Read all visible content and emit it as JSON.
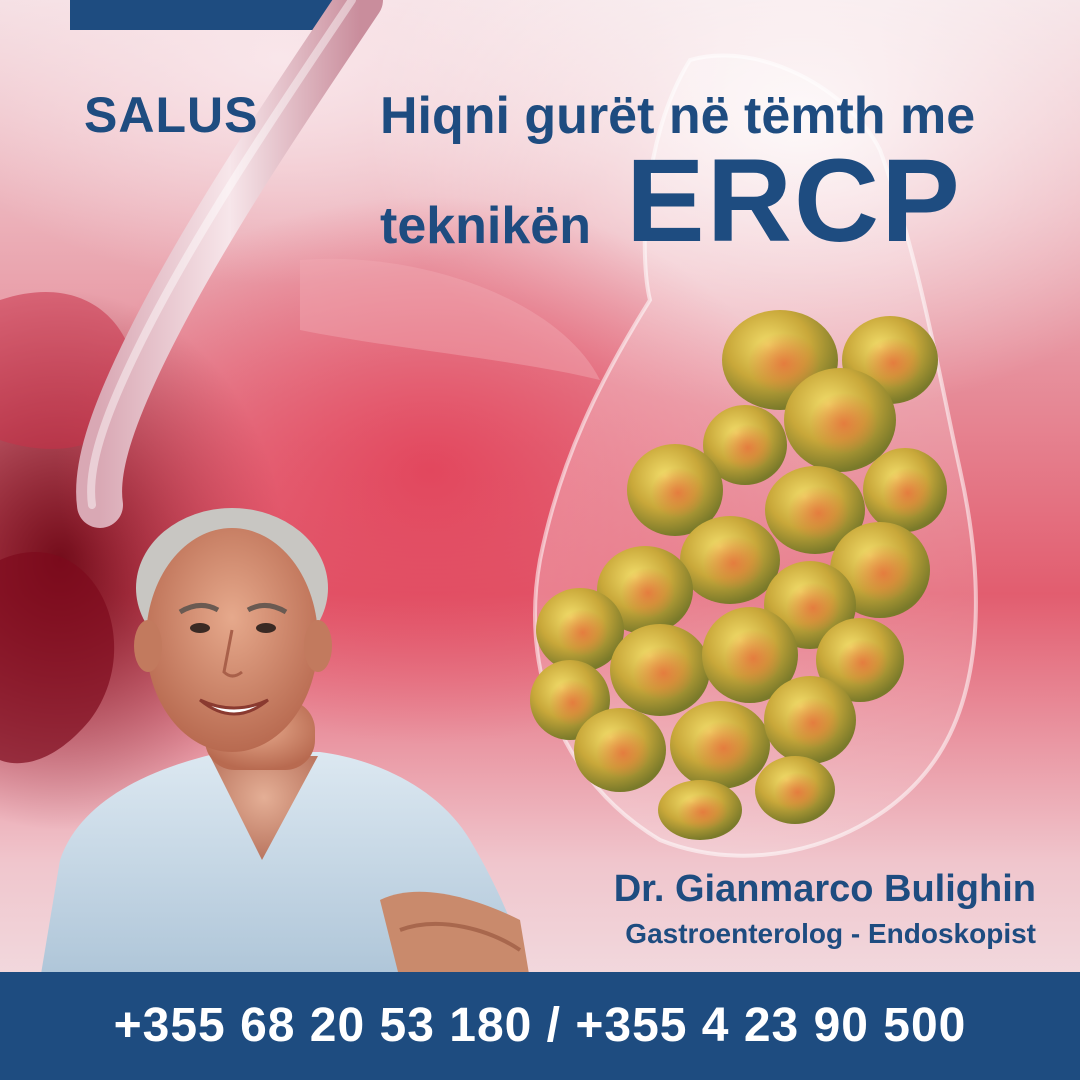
{
  "brand": {
    "name": "SALUS"
  },
  "headline": {
    "line1": "Hiqni gurët në tëmth me",
    "line2": "teknikën",
    "emphasis": "ERCP"
  },
  "doctor": {
    "name": "Dr. Gianmarco Bulighin",
    "title": "Gastroenterolog - Endoskopist"
  },
  "contact": {
    "phones": "+355 68 20 53 180 / +355 4 23 90 500"
  },
  "colors": {
    "brand_blue": "#1e4c80",
    "tissue_red": "#e25d6f",
    "stone_yellow": "#c7b23c",
    "scrubs_blue": "#c9dbe8"
  },
  "icons": {
    "illustration": "gallbladder-with-stones-illustration",
    "endoscope": "endoscope-tube",
    "portrait": "doctor-portrait"
  }
}
